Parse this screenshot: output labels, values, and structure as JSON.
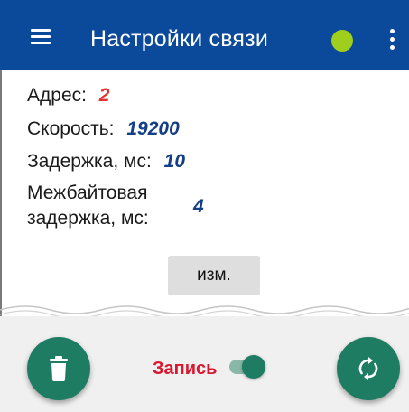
{
  "colors": {
    "appbar": "#0b4a9a",
    "status_dot": "#9fcf1c",
    "address_value": "#e0342f",
    "param_value": "#143e86",
    "fab": "#1e7c63",
    "record_label": "#d9182f"
  },
  "appbar": {
    "title": "Настройки связи",
    "menu_icon": "hamburger-menu-icon",
    "status_icon": "status-indicator-dot",
    "more_icon": "more-vertical-icon"
  },
  "settings": {
    "address": {
      "label": "Адрес:",
      "value": "2"
    },
    "speed": {
      "label": "Скорость:",
      "value": "19200"
    },
    "delay": {
      "label": "Задержка, мс:",
      "value": "10"
    },
    "interbyte_delay": {
      "label": "Межбайтовая\nзадержка, мс:",
      "value": "4"
    }
  },
  "edit_button": {
    "label": "изм."
  },
  "bottom": {
    "delete_icon": "trash-icon",
    "record_label": "Запись",
    "record_switch_on": true,
    "refresh_icon": "sync-icon"
  }
}
